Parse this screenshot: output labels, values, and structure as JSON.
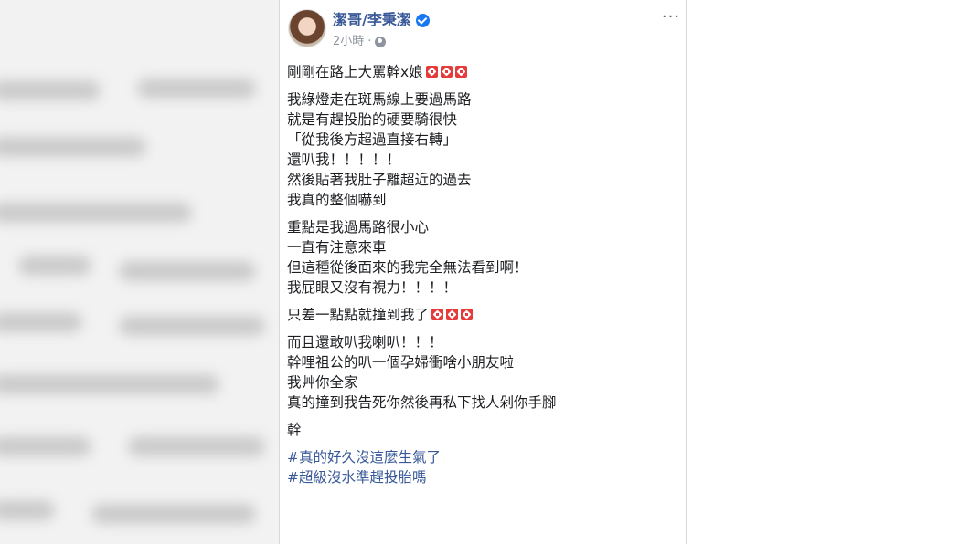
{
  "post": {
    "author": "潔哥/李秉潔",
    "time": "2小時",
    "separator": "·",
    "more_menu": "···",
    "icons": {
      "verified": "verified-badge-icon",
      "audience": "globe-icon",
      "emoji": "anger-symbol-icon"
    },
    "lines": [
      "剛剛在路上大罵幹x娘",
      "我綠燈走在斑馬線上要過馬路",
      "就是有趕投胎的硬要騎很快",
      "「從我後方超過直接右轉」",
      "還叭我！！！！！",
      "然後貼著我肚子離超近的過去",
      "我真的整個嚇到",
      "重點是我過馬路很小心",
      "一直有注意來車",
      "但這種從後面來的我完全無法看到啊！",
      "我屁眼又沒有視力！！！！",
      "只差一點點就撞到我了",
      "而且還敢叭我喇叭！！！",
      "幹哩祖公的叭一個孕婦衝啥小朋友啦",
      "我艸你全家",
      "真的撞到我告死你然後再私下找人剁你手腳",
      "幹"
    ],
    "hashtags": [
      "#真的好久沒這麼生氣了",
      "#超級沒水準趕投胎嗎"
    ]
  },
  "colors": {
    "author": "#385898",
    "hashtag": "#385898",
    "text": "#1c1e21",
    "meta": "#8d949e",
    "anger_emoji": "#e53b3b"
  }
}
